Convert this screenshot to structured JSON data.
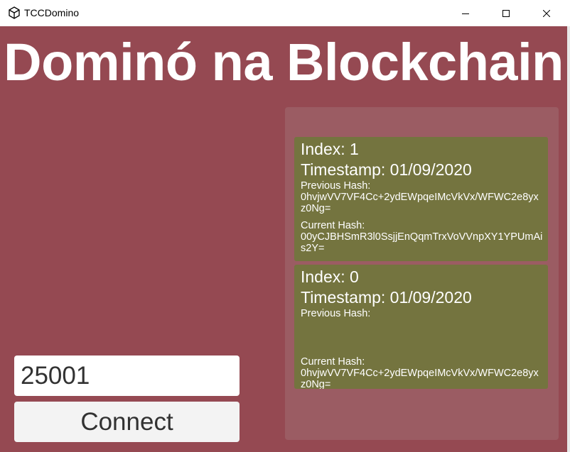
{
  "window": {
    "title": "TCCDomino",
    "icon": "unity-logo-icon"
  },
  "heading": "Dominó na Blockchain",
  "port_input": {
    "value": "25001"
  },
  "connect_button": {
    "label": "Connect"
  },
  "blocks": [
    {
      "index": "Index: 1",
      "timestamp": "Timestamp: 01/09/2020",
      "previous_hash_label": "Previous Hash:",
      "previous_hash": "0hvjwVV7VF4Cc+2ydEWpqeIMcVkVx/WFWC2e8yxz0Ng=",
      "current_hash_label": "Current Hash:",
      "current_hash": "00yCJBHSmR3l0SsjjEnQqmTrxVoVVnpXY1YPUmAis2Y="
    },
    {
      "index": "Index: 0",
      "timestamp": "Timestamp: 01/09/2020",
      "previous_hash_label": "Previous Hash:",
      "previous_hash": "",
      "current_hash_label": "Current Hash:",
      "current_hash": "0hvjwVV7VF4Cc+2ydEWpqeIMcVkVx/WFWC2e8yxz0Ng="
    }
  ],
  "colors": {
    "background": "#954952",
    "panel": "#9b5c63",
    "block": "#74743f",
    "text": "#ffffff"
  }
}
